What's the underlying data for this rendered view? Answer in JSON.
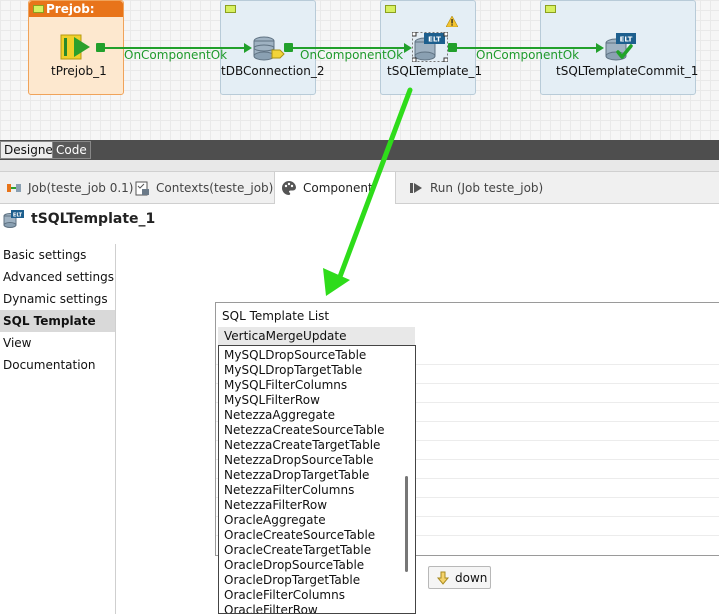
{
  "canvas": {
    "components": [
      {
        "name": "tPrejob_1",
        "header": "Prejob:"
      },
      {
        "name": "tDBConnection_2"
      },
      {
        "name": "tSQLTemplate_1",
        "badge": "ELT"
      },
      {
        "name": "tSQLTemplateCommit_1",
        "badge": "ELT"
      }
    ],
    "links": [
      "OnComponentOk",
      "OnComponentOk",
      "OnComponentOk"
    ]
  },
  "editor_tabs": [
    {
      "label": "Designer",
      "active": true
    },
    {
      "label": "Code",
      "active": false
    }
  ],
  "view_tabs": [
    {
      "label": "Job(teste_job 0.1)",
      "icon": "job-icon"
    },
    {
      "label": "Contexts(teste_job)",
      "icon": "contexts-icon"
    },
    {
      "label": "Component",
      "icon": "palette-icon",
      "active": true
    },
    {
      "label": "Run (Job teste_job)",
      "icon": "run-icon"
    }
  ],
  "panel_title": "tSQLTemplate_1",
  "nav": [
    {
      "label": "Basic settings"
    },
    {
      "label": "Advanced settings"
    },
    {
      "label": "Dynamic settings"
    },
    {
      "label": "SQL Template",
      "active": true
    },
    {
      "label": "View"
    },
    {
      "label": "Documentation"
    }
  ],
  "template_list": {
    "header": "SQL Template List",
    "selected": "VerticaMergeUpdate"
  },
  "dropdown_items": [
    "MySQLDropSourceTable",
    "MySQLDropTargetTable",
    "MySQLFilterColumns",
    "MySQLFilterRow",
    "NetezzaAggregate",
    "NetezzaCreateSourceTable",
    "NetezzaCreateTargetTable",
    "NetezzaDropSourceTable",
    "NetezzaDropTargetTable",
    "NetezzaFilterColumns",
    "NetezzaFilterRow",
    "OracleAggregate",
    "OracleCreateSourceTable",
    "OracleCreateTargetTable",
    "OracleDropSourceTable",
    "OracleDropTargetTable",
    "OracleFilterColumns",
    "OracleFilterRow"
  ],
  "buttons": {
    "down": "down"
  },
  "colors": {
    "link_green": "#22a02c",
    "prejob_orange": "#e8741a",
    "annotation_arrow": "#2edc1a"
  }
}
